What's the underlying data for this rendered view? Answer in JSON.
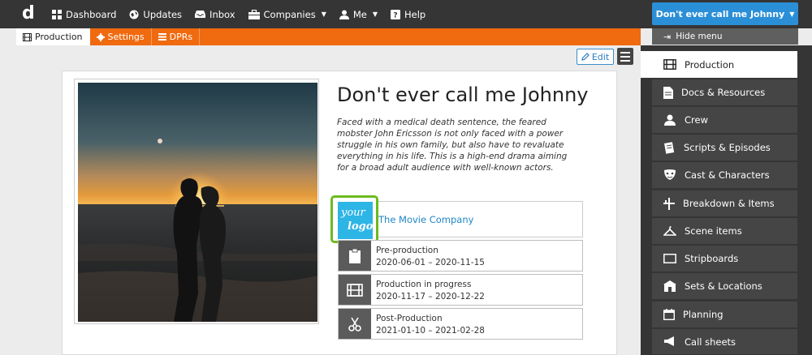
{
  "topbar": {
    "brand": "d",
    "nav": [
      {
        "label": "Dashboard",
        "icon": "dashboard-icon"
      },
      {
        "label": "Updates",
        "icon": "globe-icon"
      },
      {
        "label": "Inbox",
        "icon": "inbox-icon"
      },
      {
        "label": "Companies",
        "icon": "briefcase-icon",
        "dropdown": true
      },
      {
        "label": "Me",
        "icon": "user-icon",
        "dropdown": true
      },
      {
        "label": "Help",
        "icon": "help-icon"
      }
    ],
    "project_button": "Don't ever call me Johnny",
    "hide_menu": "Hide menu"
  },
  "tabs": [
    {
      "label": "Production",
      "active": true
    },
    {
      "label": "Settings",
      "active": false
    },
    {
      "label": "DPRs",
      "active": false
    }
  ],
  "toolbar": {
    "edit_label": "Edit"
  },
  "project": {
    "title": "Don't ever call me Johnny",
    "description": "Faced with a medical death sentence, the feared mobster John Ericsson is not only faced with a power struggle in his own family, but also have to revaluate everything in his life. This is a high-end drama aiming for a broad adult audience with well-known actors.",
    "logo_line1": "your",
    "logo_line2": "logo",
    "company": "The Movie Company",
    "phases": [
      {
        "name": "Pre-production",
        "dates": "2020-06-01 – 2020-11-15",
        "icon": "clipboard-icon"
      },
      {
        "name": "Production in progress",
        "dates": "2020-11-17 – 2020-12-22",
        "icon": "film-icon"
      },
      {
        "name": "Post-Production",
        "dates": "2021-01-10 – 2021-02-28",
        "icon": "scissors-icon"
      }
    ]
  },
  "sidebar": {
    "items": [
      {
        "label": "Production",
        "icon": "film-icon",
        "active": true
      },
      {
        "label": "Docs & Resources",
        "icon": "document-icon"
      },
      {
        "label": "Crew",
        "icon": "crew-icon"
      },
      {
        "label": "Scripts & Episodes",
        "icon": "script-icon"
      },
      {
        "label": "Cast & Characters",
        "icon": "masks-icon"
      },
      {
        "label": "Breakdown & Items",
        "icon": "breakdown-icon"
      },
      {
        "label": "Scene items",
        "icon": "hanger-icon"
      },
      {
        "label": "Stripboards",
        "icon": "stripboard-icon"
      },
      {
        "label": "Sets & Locations",
        "icon": "location-icon"
      },
      {
        "label": "Planning",
        "icon": "calendar-icon"
      },
      {
        "label": "Call sheets",
        "icon": "megaphone-icon"
      }
    ]
  },
  "colors": {
    "topbar": "#353535",
    "accent_orange": "#f06a10",
    "accent_blue": "#2b8fd8",
    "logo_outline": "#6cba1f",
    "logo_bg": "#2db5e6"
  }
}
